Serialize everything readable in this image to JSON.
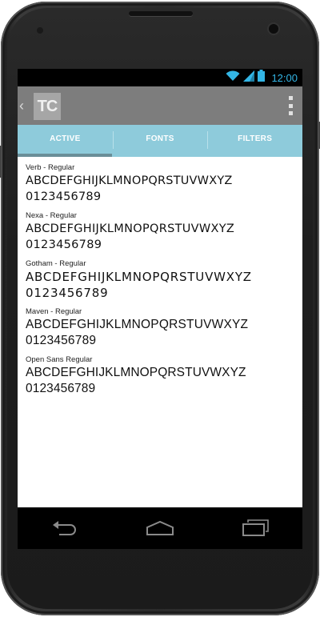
{
  "status_bar": {
    "time": "12:00",
    "icons": [
      "wifi-icon",
      "signal-icon",
      "battery-icon"
    ],
    "accent_color": "#33b5e5"
  },
  "action_bar": {
    "logo_text": "TC",
    "background_color": "#7d7d7d"
  },
  "tabs": [
    {
      "label": "ACTIVE",
      "selected": true
    },
    {
      "label": "FONTS",
      "selected": false
    },
    {
      "label": "FILTERS",
      "selected": false
    }
  ],
  "tab_bar_color": "#8ecbdb",
  "fonts": [
    {
      "name": "Verb - Regular",
      "alphabet": "ABCDEFGHIJKLMNOPQRSTUVWXYZ",
      "digits": "0123456789"
    },
    {
      "name": "Nexa - Regular",
      "alphabet": "ABCDEFGHIJKLMNOPQRSTUVWXYZ",
      "digits": "0123456789"
    },
    {
      "name": "Gotham - Regular",
      "alphabet": "ABCDEFGHIJKLMNOPQRSTUVWXYZ",
      "digits": "0123456789"
    },
    {
      "name": "Maven -  Regular",
      "alphabet": "ABCDEFGHIJKLMNOPQRSTUVWXYZ",
      "digits": "0123456789"
    },
    {
      "name": "Open Sans Regular",
      "alphabet": "ABCDEFGHIJKLMNOPQRSTUVWXYZ",
      "digits": "0123456789"
    }
  ],
  "nav_bar": {
    "icons": [
      "back-icon",
      "home-icon",
      "recent-apps-icon"
    ]
  }
}
